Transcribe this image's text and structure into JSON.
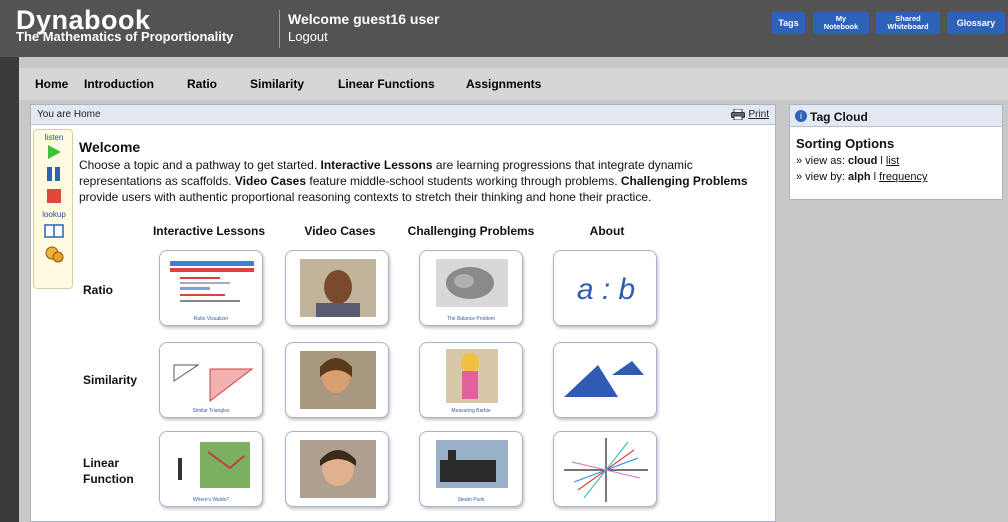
{
  "header": {
    "logo_title": "Dynabook",
    "logo_subtitle": "The Mathematics of Proportionality",
    "welcome": "Welcome guest16 user",
    "logout": "Logout",
    "buttons": {
      "tags": "Tags",
      "notebook_line1": "My",
      "notebook_line2": "Notebook",
      "shared_line1": "Shared",
      "shared_line2": "Whiteboard",
      "glossary": "Glossary"
    }
  },
  "nav": {
    "items": [
      "Home",
      "Introduction",
      "Ratio",
      "Similarity",
      "Linear Functions",
      "Assignments"
    ]
  },
  "breadcrumb": "You are Home",
  "print_label": "Print",
  "toolbar": {
    "listen": "listen",
    "lookup": "lookup"
  },
  "welcome": {
    "title": "Welcome",
    "p1": "Choose a topic and a pathway to get started. ",
    "b1": "Interactive Lessons",
    "p2": " are learning progressions that integrate dynamic representations as scaffolds. ",
    "b2": "Video Cases",
    "p3": " feature middle-school students working through problems. ",
    "b3": "Challenging Problems",
    "p4": " provide users with authentic proportional reasoning contexts to stretch their thinking and hone their practice."
  },
  "grid": {
    "columns": [
      "Interactive Lessons",
      "Video Cases",
      "Challenging Problems",
      "About"
    ],
    "rows": [
      "Ratio",
      "Similarity",
      "Linear",
      "Function"
    ],
    "captions": {
      "ratio_lesson": "Ratio Visualizer",
      "ratio_problem": "The Balance Problem",
      "sim_lesson": "Similar Triangles",
      "sim_problem": "Measuring Barbie",
      "lin_lesson": "Where's Waldo?",
      "lin_problem": "Steam Punk"
    },
    "about_ratio": "a : b"
  },
  "tagcloud": {
    "title": "Tag Cloud",
    "sorting_title": "Sorting Options",
    "view_as_prefix": "» view as: ",
    "view_as_active": "cloud",
    "view_as_sep": " l ",
    "view_as_link": "list",
    "view_by_prefix": "» view by: ",
    "view_by_active": "alph",
    "view_by_sep": " l ",
    "view_by_link": "frequency"
  },
  "colors": {
    "header_bg": "#535353",
    "button_blue": "#2c62b8",
    "about_blue": "#2f5bb5"
  },
  "icons": [
    "printer-icon",
    "play-icon",
    "pause-icon",
    "stop-icon",
    "book-icon",
    "lookup-person-icon",
    "info-icon"
  ]
}
